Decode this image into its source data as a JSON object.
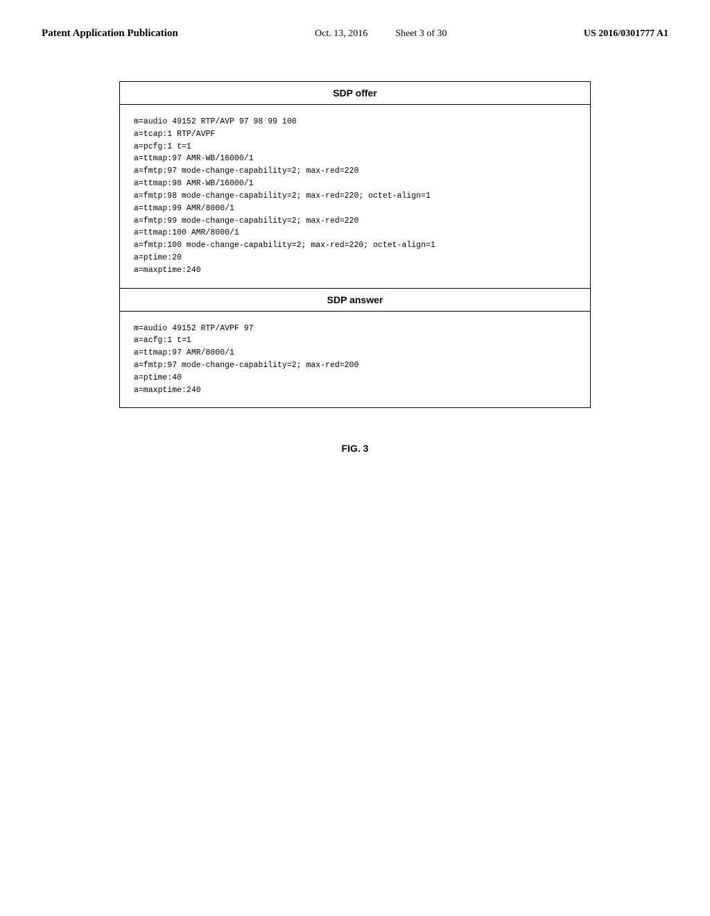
{
  "header": {
    "left": "Patent Application Publication",
    "date": "Oct. 13, 2016",
    "sheet": "Sheet 3 of 30",
    "patent": "US 2016/0301777 A1"
  },
  "diagram": {
    "sdp_offer": {
      "title": "SDP offer",
      "lines": [
        "m=audio 49152 RTP/AVP 97 98 99 100",
        "a=tcap:1 RTP/AVPF",
        "a=pcfg:1 t=1",
        "a=ttmap:97 AMR-WB/16000/1",
        "a=fmtp:97 mode-change-capability=2; max-red=220",
        "a=ttmap:98 AMR-WB/16000/1",
        "a=fmtp:98 mode-change-capability=2; max-red=220; octet-align=1",
        "a=ttmap:99 AMR/8000/1",
        "a=fmtp:99 mode-change-capability=2; max-red=220",
        "a=ttmap:100 AMR/8000/1",
        "a=fmtp:100 mode-change-capability=2; max-red=220; octet-align=1",
        "a=ptime:20",
        "a=maxptime:240"
      ]
    },
    "sdp_answer": {
      "title": "SDP answer",
      "lines": [
        "m=audio 49152 RTP/AVPF 97",
        "a=acfg:1 t=1",
        "a=ttmap:97 AMR/8000/1",
        "a=fmtp:97 mode-change-capability=2; max-red=200",
        "a=ptime:40",
        "a=maxptime:240"
      ]
    }
  },
  "figure": {
    "label": "FIG. 3"
  }
}
